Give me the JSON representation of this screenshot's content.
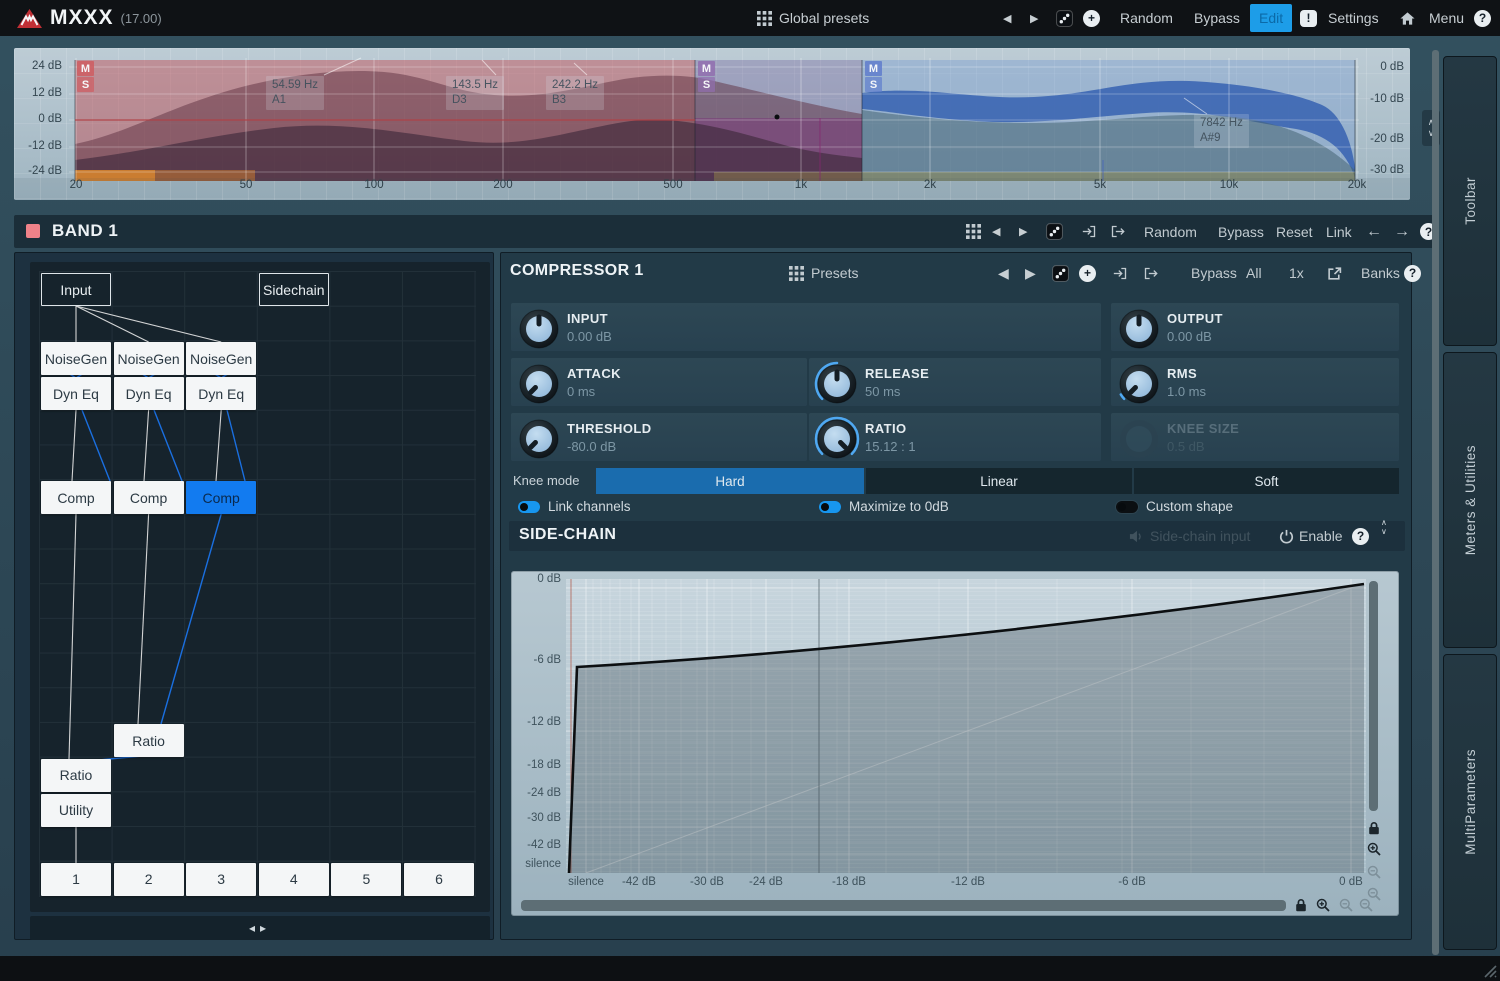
{
  "topbar": {
    "title": "MXXX",
    "version": "(17.00)",
    "global_presets": "Global presets",
    "random": "Random",
    "bypass": "Bypass",
    "edit": "Edit",
    "settings": "Settings",
    "menu": "Menu"
  },
  "eq": {
    "db_left": [
      "24 dB",
      "12 dB",
      "0 dB",
      "-12 dB",
      "-24 dB"
    ],
    "db_right": [
      "0 dB",
      "-10 dB",
      "-20 dB",
      "-30 dB"
    ],
    "freqs": [
      "20",
      "50",
      "100",
      "200",
      "500",
      "1k",
      "2k",
      "5k",
      "10k",
      "20k"
    ],
    "band_buttons": {
      "mid": "M",
      "side": "S"
    },
    "markers": [
      {
        "freq": "54.59 Hz",
        "note": "A1"
      },
      {
        "freq": "143.5 Hz",
        "note": "D3"
      },
      {
        "freq": "242.2 Hz",
        "note": "B3"
      },
      {
        "freq": "7842 Hz",
        "note": "A#9"
      }
    ]
  },
  "band_bar": {
    "title": "BAND 1",
    "random": "Random",
    "bypass": "Bypass",
    "reset": "Reset",
    "link": "Link"
  },
  "node_graph": {
    "input": "Input",
    "sidechain": "Sidechain",
    "noisegen": [
      "NoiseGen",
      "NoiseGen",
      "NoiseGen"
    ],
    "dyneq": [
      "Dyn Eq",
      "Dyn Eq",
      "Dyn Eq"
    ],
    "comp": [
      "Comp",
      "Comp",
      "Comp"
    ],
    "ratio_upper": "Ratio",
    "ratio_lower": "Ratio",
    "utility": "Utility",
    "outputs": [
      "1",
      "2",
      "3",
      "4",
      "5",
      "6"
    ]
  },
  "compressor": {
    "title": "COMPRESSOR 1",
    "presets": "Presets",
    "bypass": "Bypass",
    "all": "All",
    "one_x": "1x",
    "banks": "Banks",
    "knobs": {
      "input": {
        "label": "INPUT",
        "value": "0.00 dB"
      },
      "output": {
        "label": "OUTPUT",
        "value": "0.00 dB"
      },
      "attack": {
        "label": "ATTACK",
        "value": "0 ms"
      },
      "release": {
        "label": "RELEASE",
        "value": "50 ms"
      },
      "rms": {
        "label": "RMS",
        "value": "1.0 ms"
      },
      "threshold": {
        "label": "THRESHOLD",
        "value": "-80.0 dB"
      },
      "ratio": {
        "label": "RATIO",
        "value": "15.12 : 1"
      },
      "knee_size": {
        "label": "KNEE SIZE",
        "value": "0.5 dB"
      }
    },
    "knee_mode": {
      "label": "Knee mode",
      "options": [
        "Hard",
        "Linear",
        "Soft"
      ],
      "selected": "Hard"
    },
    "toggles": [
      {
        "label": "Link channels",
        "on": true
      },
      {
        "label": "Maximize to 0dB",
        "on": true
      },
      {
        "label": "Custom shape",
        "on": false
      }
    ]
  },
  "sidechain_section": {
    "title": "SIDE-CHAIN",
    "input_label": "Side-chain input",
    "enable": "Enable"
  },
  "chart_data": {
    "type": "line",
    "title": "Compressor transfer curve (input level vs output level)",
    "x_ticks": [
      "silence",
      "-42 dB",
      "-30 dB",
      "-24 dB",
      "-18 dB",
      "-12 dB",
      "-6 dB",
      "0 dB"
    ],
    "y_ticks": [
      "0 dB",
      "-6 dB",
      "-12 dB",
      "-18 dB",
      "-24 dB",
      "-30 dB",
      "-42 dB",
      "silence"
    ],
    "points": [
      {
        "x": "silence",
        "y": "silence"
      },
      {
        "x": "-80 dB",
        "y": "-5.5 dB"
      },
      {
        "x": "0 dB",
        "y": "0 dB"
      }
    ],
    "grid": true,
    "accent_color": "#4fa8f2"
  },
  "sidebar": {
    "tabs": [
      "Toolbar",
      "Meters & Utilities",
      "MultiParameters"
    ]
  }
}
